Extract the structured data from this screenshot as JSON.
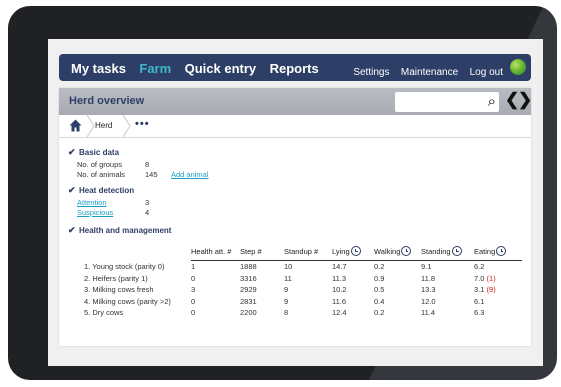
{
  "topnav": {
    "items": [
      {
        "label": "My tasks",
        "active": false
      },
      {
        "label": "Farm",
        "active": true
      },
      {
        "label": "Quick entry",
        "active": false
      },
      {
        "label": "Reports",
        "active": false
      }
    ],
    "settings_label": "Settings",
    "maintenance_label": "Maintenance",
    "logout_label": "Log out",
    "active_color": "#40b6c8",
    "bar_color": "#2d3e67"
  },
  "header": {
    "title": "Herd overview",
    "search_value": "",
    "search_icon": "search-icon",
    "prev_icon": "chevron-left-icon",
    "next_icon": "chevron-right-icon"
  },
  "breadcrumb": {
    "home_icon": "home-icon",
    "crumb": "Herd",
    "more": "•••"
  },
  "basic_data": {
    "title": "Basic data",
    "groups_label": "No. of groups",
    "groups_value": "8",
    "animals_label": "No. of animals",
    "animals_value": "145",
    "add_animal": "Add animal"
  },
  "heat_detection": {
    "title": "Heat detection",
    "attention_label": "Attention",
    "attention_value": "3",
    "suspicious_label": "Suspicious",
    "suspicious_value": "4"
  },
  "health": {
    "title": "Health and management",
    "columns": [
      "Health att. #",
      "Step #",
      "Standup #",
      "Lying",
      "Walking",
      "Standing",
      "Eating"
    ],
    "rows": [
      {
        "name": "1. Young stock (parity 0)",
        "health_att": "1",
        "step": "1888",
        "standup": "10",
        "lying": "14.7",
        "walking": "0.2",
        "standing": "9.1",
        "eating": "6.2",
        "eating_flag": ""
      },
      {
        "name": "2. Heifers (parity 1)",
        "health_att": "0",
        "step": "3316",
        "standup": "11",
        "lying": "11.3",
        "walking": "0.9",
        "standing": "11.8",
        "eating": "7.0",
        "eating_flag": "(1)"
      },
      {
        "name": "3. Milking cows fresh",
        "health_att": "3",
        "step": "2929",
        "standup": "9",
        "lying": "10.2",
        "walking": "0.5",
        "standing": "13.3",
        "eating": "3.1",
        "eating_flag": "(9)"
      },
      {
        "name": "4. Milking cows (parity >2)",
        "health_att": "0",
        "step": "2831",
        "standup": "9",
        "lying": "11.6",
        "walking": "0.4",
        "standing": "12.0",
        "eating": "6.1",
        "eating_flag": ""
      },
      {
        "name": "5. Dry cows",
        "health_att": "0",
        "step": "2200",
        "standup": "8",
        "lying": "12.4",
        "walking": "0.2",
        "standing": "11.4",
        "eating": "6.3",
        "eating_flag": ""
      }
    ],
    "flag_color": "#d42020"
  }
}
